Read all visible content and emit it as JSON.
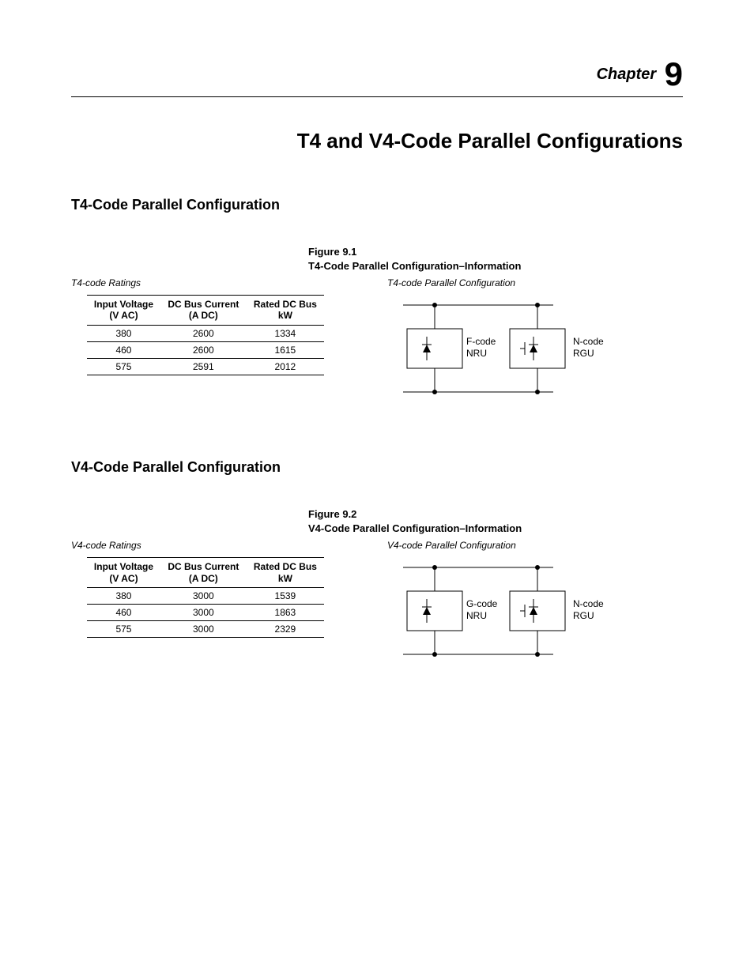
{
  "chapter": {
    "label": "Chapter",
    "number": "9"
  },
  "main_title": "T4 and V4-Code Parallel Configurations",
  "sections": {
    "t4": {
      "title": "T4-Code Parallel Configuration",
      "figure_num": "Figure 9.1",
      "figure_title": "T4-Code Parallel Configuration–Information",
      "ratings_caption": "T4-code Ratings",
      "diagram_caption": "T4-code Parallel Configuration",
      "table": {
        "headers": {
          "c1a": "Input Voltage",
          "c1b": "(V AC)",
          "c2a": "DC Bus Current",
          "c2b": "(A DC)",
          "c3a": "Rated DC Bus",
          "c3b": "kW"
        },
        "rows": [
          {
            "v": "380",
            "a": "2600",
            "kw": "1334"
          },
          {
            "v": "460",
            "a": "2600",
            "kw": "1615"
          },
          {
            "v": "575",
            "a": "2591",
            "kw": "2012"
          }
        ]
      },
      "diagram": {
        "left1": "F-code",
        "left2": "NRU",
        "right1": "N-code",
        "right2": "RGU"
      }
    },
    "v4": {
      "title": "V4-Code Parallel Configuration",
      "figure_num": "Figure 9.2",
      "figure_title": "V4-Code Parallel Configuration–Information",
      "ratings_caption": "V4-code Ratings",
      "diagram_caption": "V4-code Parallel Configuration",
      "table": {
        "headers": {
          "c1a": "Input Voltage",
          "c1b": "(V AC)",
          "c2a": "DC Bus Current",
          "c2b": "(A DC)",
          "c3a": "Rated DC Bus",
          "c3b": "kW"
        },
        "rows": [
          {
            "v": "380",
            "a": "3000",
            "kw": "1539"
          },
          {
            "v": "460",
            "a": "3000",
            "kw": "1863"
          },
          {
            "v": "575",
            "a": "3000",
            "kw": "2329"
          }
        ]
      },
      "diagram": {
        "left1": "G-code",
        "left2": "NRU",
        "right1": "N-code",
        "right2": "RGU"
      }
    }
  },
  "chart_data": [
    {
      "type": "table",
      "title": "T4-code Ratings",
      "columns": [
        "Input Voltage (V AC)",
        "DC Bus Current (A DC)",
        "Rated DC Bus kW"
      ],
      "rows": [
        [
          380,
          2600,
          1334
        ],
        [
          460,
          2600,
          1615
        ],
        [
          575,
          2591,
          2012
        ]
      ]
    },
    {
      "type": "table",
      "title": "V4-code Ratings",
      "columns": [
        "Input Voltage (V AC)",
        "DC Bus Current (A DC)",
        "Rated DC Bus kW"
      ],
      "rows": [
        [
          380,
          3000,
          1539
        ],
        [
          460,
          3000,
          1863
        ],
        [
          575,
          3000,
          2329
        ]
      ]
    }
  ]
}
